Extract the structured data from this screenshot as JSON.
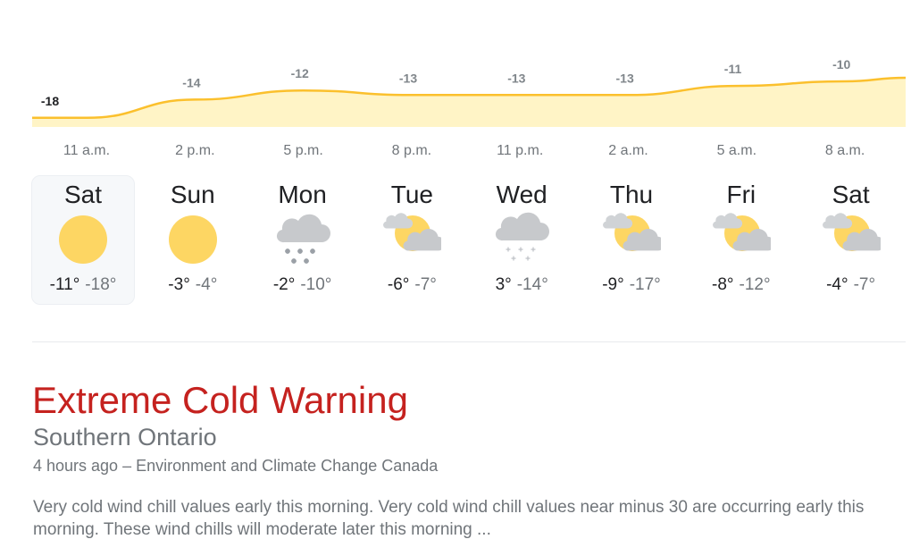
{
  "chart_data": {
    "type": "area",
    "x": [
      "11 a.m.",
      "2 p.m.",
      "5 p.m.",
      "8 p.m.",
      "11 p.m.",
      "2 a.m.",
      "5 a.m.",
      "8 a.m."
    ],
    "values": [
      -18,
      -14,
      -12,
      -13,
      -13,
      -13,
      -11,
      -10
    ],
    "labels": [
      "-18",
      "-14",
      "-12",
      "-13",
      "-13",
      "-13",
      "-11",
      "-10"
    ],
    "colors": {
      "line": "#fbc02d",
      "fill": "#fff4c6"
    }
  },
  "forecast": {
    "days": [
      {
        "name": "Sat",
        "icon": "sunny-icon",
        "high": "-11°",
        "low": "-18°",
        "selected": true
      },
      {
        "name": "Sun",
        "icon": "sunny-icon",
        "high": "-3°",
        "low": "-4°"
      },
      {
        "name": "Mon",
        "icon": "snow-icon",
        "high": "-2°",
        "low": "-10°"
      },
      {
        "name": "Tue",
        "icon": "partly-cloudy-icon",
        "high": "-6°",
        "low": "-7°"
      },
      {
        "name": "Wed",
        "icon": "flurries-icon",
        "high": "3°",
        "low": "-14°"
      },
      {
        "name": "Thu",
        "icon": "partly-cloudy-icon",
        "high": "-9°",
        "low": "-17°"
      },
      {
        "name": "Fri",
        "icon": "partly-cloudy-icon",
        "high": "-8°",
        "low": "-12°"
      },
      {
        "name": "Sat",
        "icon": "partly-cloudy-icon",
        "high": "-4°",
        "low": "-7°"
      }
    ]
  },
  "alert": {
    "title": "Extreme Cold Warning",
    "region": "Southern Ontario",
    "meta": "4 hours ago – Environment and Climate Change Canada",
    "body": "Very cold wind chill values early this morning. Very cold wind chill values near minus 30 are occurring early this morning. These wind chills will moderate later this morning ...",
    "color": "#c5221f"
  }
}
